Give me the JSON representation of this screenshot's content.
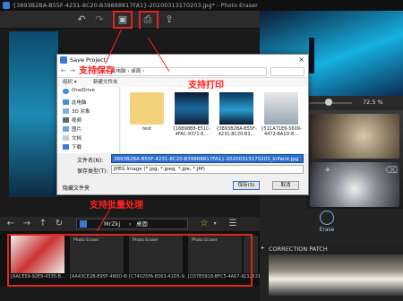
{
  "window": {
    "title": "{3893B2BA-B55F-4231-8C20-B39888817FA1}-20200313170203.jpg* - Photo Eraser"
  },
  "toolbar": {
    "icons": [
      "undo-icon",
      "redo-icon",
      "save-icon",
      "print-icon",
      "share-icon"
    ]
  },
  "zoom": {
    "value": "72.5 %",
    "fraction": 0.725
  },
  "right_panel": {
    "erase_label": "Erase",
    "correction_label": "CORRECTION PATCH"
  },
  "nav": {
    "path_user": "MrZkj",
    "path_sep": "›",
    "path_folder": "桌面"
  },
  "filmstrip": {
    "items": [
      {
        "caption": "[AACE59-92E9-4335-B..."
      },
      {
        "caption": "[AA43CE2B-E95F-4B0D-8F..."
      },
      {
        "caption": "[C74025FA-E063-41D5-9..."
      },
      {
        "caption": "[D37E0918-BFC5-4A67-9..."
      },
      {
        "caption": "132531..."
      }
    ],
    "thumb_label": "Photo Eraser"
  },
  "dialog": {
    "title": "Save Project",
    "close": "×",
    "breadcrumb": "« 此电脑 › 桌面 ›",
    "organize": "组织 ▾",
    "new_folder": "新建文件夹",
    "sidebar": [
      {
        "label": "OneDrive",
        "icon": "cloud-icon"
      },
      {
        "label": "此电脑",
        "icon": "computer-icon"
      },
      {
        "label": "3D 对象",
        "icon": "cube-icon"
      },
      {
        "label": "视频",
        "icon": "video-icon"
      },
      {
        "label": "图片",
        "icon": "picture-icon"
      },
      {
        "label": "文档",
        "icon": "document-icon"
      },
      {
        "label": "下载",
        "icon": "download-icon"
      }
    ],
    "files": [
      {
        "name": "test"
      },
      {
        "name": "{16B98B8-E51C-4FAC-9371-E..."
      },
      {
        "name": "{3893B2BA-B55F-4231-8C20-B3..."
      },
      {
        "name": "{51CA71E6-5609-4472-BA1D-8..."
      }
    ],
    "filename_label": "文件名(N):",
    "filename_value": "3893B2BA-B55F-4231-8C20-B39888817FA1}-20200313170203_InPaint.jpg",
    "filetype_label": "保存类型(T):",
    "filetype_value": "JPEG Image (*.jpg, *.jpeg, *.jpe, *.jfif)",
    "hide_folders": "隐藏文件夹",
    "save_button": "保存(S)",
    "cancel_button": "取消"
  },
  "annotations": {
    "save": "支持保存",
    "print": "支持打印",
    "batch": "支持批量处理"
  },
  "colors": {
    "annotation_red": "#e0241f",
    "selection_blue": "#2f6fd0",
    "app_background": "#1c1c1c"
  }
}
